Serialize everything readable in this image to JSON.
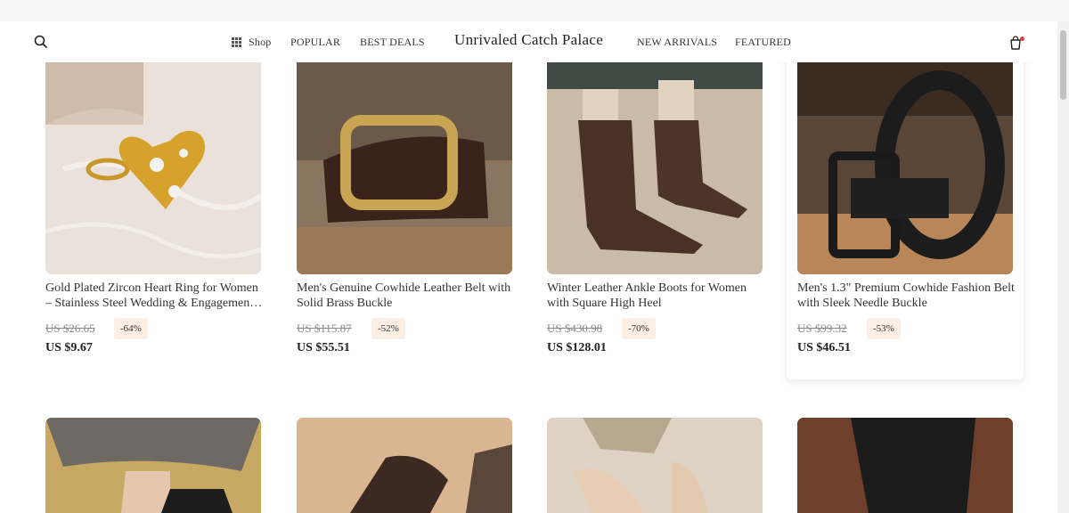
{
  "header": {
    "brand": "Unrivaled Catch Palace",
    "nav": {
      "shop": "Shop",
      "popular": "POPULAR",
      "best_deals": "BEST DEALS",
      "new_arrivals": "NEW ARRIVALS",
      "featured": "FEATURED"
    }
  },
  "products": [
    {
      "title": "Gold Plated Zircon Heart Ring for Women – Stainless Steel Wedding & Engagement Ring",
      "old_price": "US $26.65",
      "discount": "-64%",
      "price": "US $9.67"
    },
    {
      "title": "Men's Genuine Cowhide Leather Belt with Solid Brass Buckle",
      "old_price": "US $115.87",
      "discount": "-52%",
      "price": "US $55.51"
    },
    {
      "title": "Winter Leather Ankle Boots for Women with Square High Heel",
      "old_price": "US $430.98",
      "discount": "-70%",
      "price": "US $128.01"
    },
    {
      "title": "Men's 1.3\" Premium Cowhide Fashion Belt with Sleek Needle Buckle",
      "old_price": "US $99.32",
      "discount": "-53%",
      "price": "US $46.51"
    }
  ],
  "colors": {
    "badge_bg": "#fcefe6",
    "cart_dot": "#e03b3b"
  }
}
